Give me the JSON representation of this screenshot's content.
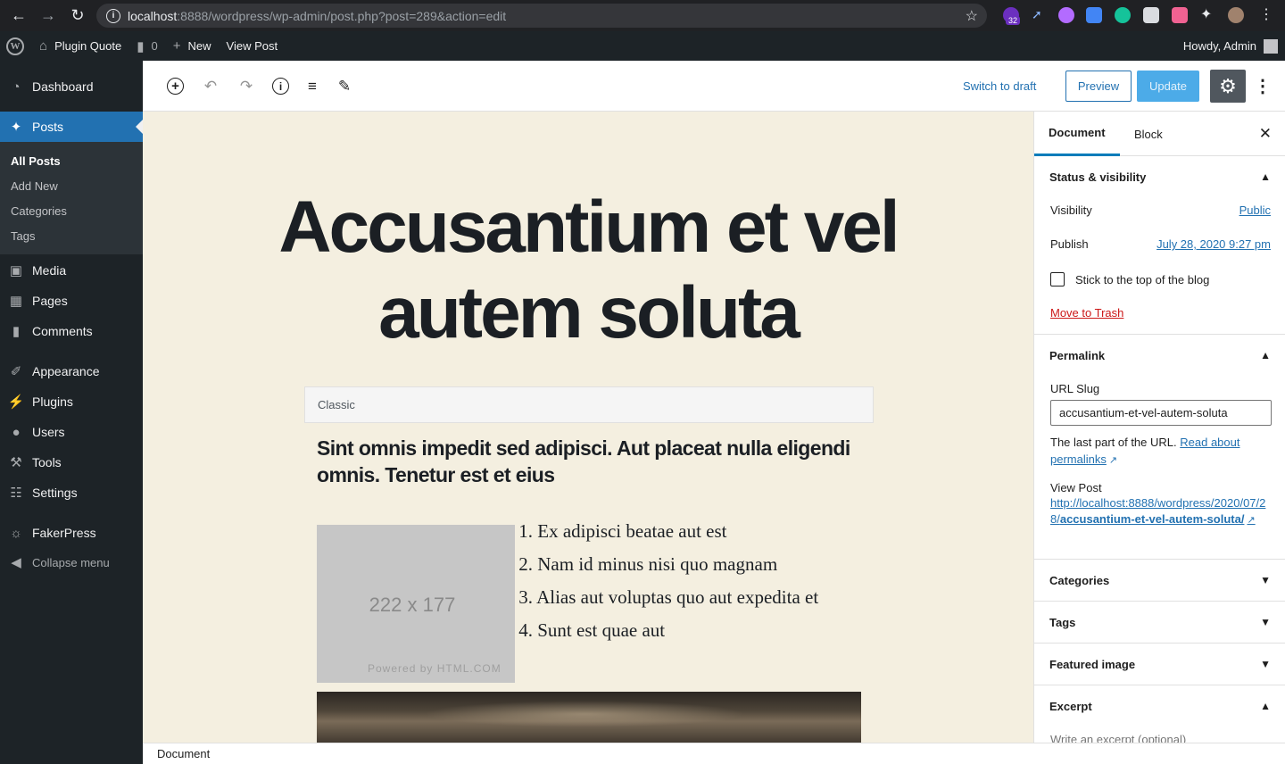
{
  "browser": {
    "url_host": "localhost",
    "url_rest": ":8888/wordpress/wp-admin/post.php?post=289&action=edit",
    "extension_badge": "32"
  },
  "adminbar": {
    "site_name": "Plugin Quote",
    "comments_count": "0",
    "new_label": "New",
    "view_post_label": "View Post",
    "howdy": "Howdy, Admin"
  },
  "sidebar": {
    "dashboard": "Dashboard",
    "posts": "Posts",
    "sub_all_posts": "All Posts",
    "sub_add_new": "Add New",
    "sub_categories": "Categories",
    "sub_tags": "Tags",
    "media": "Media",
    "pages": "Pages",
    "comments": "Comments",
    "appearance": "Appearance",
    "plugins": "Plugins",
    "users": "Users",
    "tools": "Tools",
    "settings": "Settings",
    "fakerpress": "FakerPress",
    "collapse": "Collapse menu"
  },
  "toolbar": {
    "switch_to_draft": "Switch to draft",
    "preview": "Preview",
    "update": "Update"
  },
  "content": {
    "title_line1": "Accusantium et vel",
    "title_line2": "autem soluta",
    "classic_label": "Classic",
    "heading": "Sint omnis impedit sed adipisci. Aut placeat nulla eligendi omnis. Tenetur est et eius",
    "image_dims": "222 x 177",
    "image_powered": "Powered by HTML.COM",
    "list": [
      {
        "num": "1.",
        "text": "Ex adipisci beatae aut est"
      },
      {
        "num": "2.",
        "text": "Nam id minus nisi quo magnam"
      },
      {
        "num": "3.",
        "text": "Alias aut voluptas quo aut expedita et"
      },
      {
        "num": "4.",
        "text": "Sunt est quae aut"
      }
    ]
  },
  "footer": {
    "breadcrumb": "Document"
  },
  "settings_panel": {
    "tab_document": "Document",
    "tab_block": "Block",
    "status_title": "Status & visibility",
    "visibility_label": "Visibility",
    "visibility_value": "Public",
    "publish_label": "Publish",
    "publish_value": "July 28, 2020 9:27 pm",
    "sticky_label": "Stick to the top of the blog",
    "trash": "Move to Trash",
    "permalink_title": "Permalink",
    "url_slug_label": "URL Slug",
    "url_slug_value": "accusantium-et-vel-autem-soluta",
    "url_help": "The last part of the URL.",
    "read_about": "Read about permalinks",
    "view_post_label": "View Post",
    "view_post_url_prefix": "http://localhost:8888/wordpress/2020/07/28/",
    "view_post_url_slug": "accusantium-et-vel-autem-soluta/",
    "categories_title": "Categories",
    "tags_title": "Tags",
    "featured_image_title": "Featured image",
    "excerpt_title": "Excerpt",
    "excerpt_placeholder": "Write an excerpt (optional)"
  },
  "colors": {
    "admin_dark": "#1d2327",
    "accent_blue": "#2271b1",
    "canvas_bg": "#f4efe0",
    "trash_red": "#cc1818"
  }
}
